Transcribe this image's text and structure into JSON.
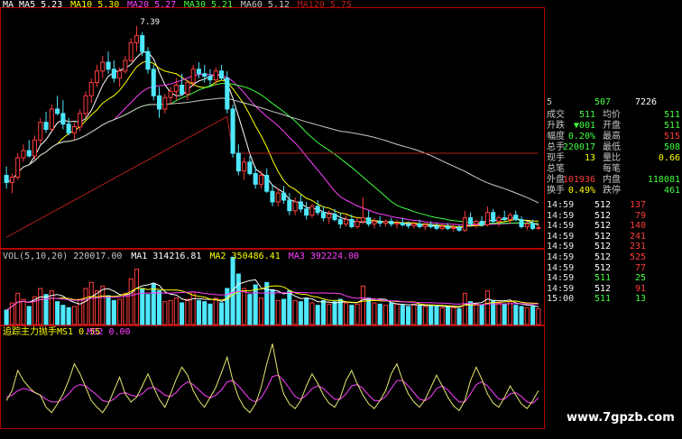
{
  "colors": {
    "up": "#ff3c3c",
    "down": "#4fe8ff",
    "white": "#ffffff",
    "yellow": "#ffff00",
    "magenta": "#ff40ff",
    "green": "#40ff40",
    "axis": "#b40000",
    "ma5": "#ffffff",
    "ma10": "#ffff00",
    "ma20": "#ff40ff",
    "ma30": "#40ff40",
    "ma60": "#c8c8c8",
    "ma120": "#b41e1e"
  },
  "price_legend": [
    {
      "text": "MA MA5 5.23",
      "color": "#ffffff"
    },
    {
      "text": "MA10 5.30",
      "color": "#ffff00"
    },
    {
      "text": "MA20 5.27",
      "color": "#ff40ff"
    },
    {
      "text": "MA30 5.21",
      "color": "#40ff40"
    },
    {
      "text": "MA60 5.12",
      "color": "#c8c8c8"
    },
    {
      "text": "MA120 5.75",
      "color": "#b41e1e"
    }
  ],
  "high_marker": "7.39",
  "volume_legend": [
    {
      "text": "VOL(5,10,20) 220017.00",
      "color": "#c8c8c8"
    },
    {
      "text": "MA1 314216.81",
      "color": "#ffffff"
    },
    {
      "text": "MA2 350486.41",
      "color": "#ffff00"
    },
    {
      "text": "MA3 392224.00",
      "color": "#ff40ff"
    }
  ],
  "indicator_legend": [
    {
      "text": "追踪主力抛手MS1 0.55",
      "color": "#ffff00"
    },
    {
      "text": "MS2 0.00",
      "color": "#ff40ff"
    }
  ],
  "quote_header": {
    "code": "5",
    "price": "507",
    "volume": "7226"
  },
  "quote_rows": [
    {
      "l1": "成交",
      "v1": "511",
      "l2": "均价",
      "v2": "511",
      "c1": "#40ff40",
      "c2": "#40ff40"
    },
    {
      "l1": "升跌",
      "v1": "▼001",
      "l2": "开盘",
      "v2": "511",
      "c1": "#40ff40",
      "c2": "#40ff40"
    },
    {
      "l1": "幅度",
      "v1": "0.20%",
      "l2": "最高",
      "v2": "515",
      "c1": "#40ff40",
      "c2": "#ff3c3c"
    },
    {
      "l1": "总手",
      "v1": "220017",
      "l2": "最低",
      "v2": "508",
      "c1": "#40ff40",
      "c2": "#40ff40"
    },
    {
      "l1": "现手",
      "v1": "13",
      "l2": "量比",
      "v2": "0.66",
      "c1": "#ffff00",
      "c2": "#ffff00"
    },
    {
      "l1": "总笔",
      "v1": "",
      "l2": "每笔",
      "v2": "",
      "c1": "#ffff00",
      "c2": "#ffff00"
    },
    {
      "l1": "外盘",
      "v1": "101936",
      "l2": "内盘",
      "v2": "118081",
      "c1": "#ff3c3c",
      "c2": "#40ff40"
    },
    {
      "l1": "换手",
      "v1": "0.49%",
      "l2": "跌停",
      "v2": "461",
      "c1": "#ffff00",
      "c2": "#40ff40"
    }
  ],
  "ticks": [
    {
      "time": "14:59",
      "price": "512",
      "vol": "137"
    },
    {
      "time": "14:59",
      "price": "512",
      "vol": "79"
    },
    {
      "time": "14:59",
      "price": "512",
      "vol": "140"
    },
    {
      "time": "14:59",
      "price": "512",
      "vol": "241"
    },
    {
      "time": "14:59",
      "price": "512",
      "vol": "231"
    },
    {
      "time": "14:59",
      "price": "512",
      "vol": "525"
    },
    {
      "time": "14:59",
      "price": "512",
      "vol": "77"
    },
    {
      "time": "14:59",
      "price": "511",
      "vol": "25"
    },
    {
      "time": "14:59",
      "price": "512",
      "vol": "91"
    },
    {
      "time": "15:00",
      "price": "511",
      "vol": "13"
    }
  ],
  "watermark": "www.7gpzb.com",
  "chart_data": {
    "type": "candlestick",
    "candles": [
      [
        5.7,
        5.8,
        5.55,
        5.62
      ],
      [
        5.62,
        5.72,
        5.5,
        5.68
      ],
      [
        5.68,
        5.95,
        5.65,
        5.9
      ],
      [
        5.9,
        6.05,
        5.85,
        5.98
      ],
      [
        5.98,
        6.1,
        5.9,
        5.92
      ],
      [
        5.92,
        6.15,
        5.88,
        6.1
      ],
      [
        6.1,
        6.35,
        6.05,
        6.3
      ],
      [
        6.3,
        6.42,
        6.18,
        6.22
      ],
      [
        6.22,
        6.5,
        6.2,
        6.45
      ],
      [
        6.45,
        6.6,
        6.38,
        6.4
      ],
      [
        6.4,
        6.55,
        6.22,
        6.28
      ],
      [
        6.28,
        6.35,
        6.15,
        6.18
      ],
      [
        6.18,
        6.3,
        6.1,
        6.25
      ],
      [
        6.25,
        6.45,
        6.2,
        6.4
      ],
      [
        6.4,
        6.65,
        6.35,
        6.6
      ],
      [
        6.6,
        6.8,
        6.52,
        6.75
      ],
      [
        6.75,
        6.95,
        6.7,
        6.88
      ],
      [
        6.88,
        7.05,
        6.8,
        6.98
      ],
      [
        6.98,
        7.1,
        6.85,
        6.9
      ],
      [
        6.9,
        7.0,
        6.75,
        6.8
      ],
      [
        6.8,
        6.92,
        6.7,
        6.88
      ],
      [
        6.88,
        7.05,
        6.85,
        7.0
      ],
      [
        7.0,
        7.25,
        6.98,
        7.2
      ],
      [
        7.2,
        7.39,
        7.1,
        7.28
      ],
      [
        7.28,
        7.32,
        7.05,
        7.1
      ],
      [
        7.1,
        7.15,
        6.85,
        6.9
      ],
      [
        6.9,
        6.95,
        6.55,
        6.6
      ],
      [
        6.6,
        6.7,
        6.35,
        6.45
      ],
      [
        6.45,
        6.62,
        6.4,
        6.58
      ],
      [
        6.58,
        6.7,
        6.5,
        6.65
      ],
      [
        6.65,
        6.8,
        6.55,
        6.72
      ],
      [
        6.72,
        6.85,
        6.6,
        6.62
      ],
      [
        6.62,
        6.78,
        6.55,
        6.75
      ],
      [
        6.75,
        6.95,
        6.7,
        6.9
      ],
      [
        6.9,
        6.98,
        6.8,
        6.85
      ],
      [
        6.85,
        6.95,
        6.75,
        6.82
      ],
      [
        6.82,
        6.9,
        6.7,
        6.78
      ],
      [
        6.78,
        6.92,
        6.72,
        6.88
      ],
      [
        6.88,
        6.95,
        6.78,
        6.8
      ],
      [
        6.8,
        6.88,
        6.4,
        6.45
      ],
      [
        6.45,
        6.5,
        5.9,
        5.95
      ],
      [
        5.95,
        6.05,
        5.7,
        5.75
      ],
      [
        5.75,
        5.9,
        5.65,
        5.85
      ],
      [
        5.85,
        5.92,
        5.7,
        5.72
      ],
      [
        5.72,
        5.8,
        5.55,
        5.6
      ],
      [
        5.6,
        5.75,
        5.55,
        5.7
      ],
      [
        5.7,
        5.78,
        5.5,
        5.52
      ],
      [
        5.52,
        5.6,
        5.35,
        5.4
      ],
      [
        5.4,
        5.55,
        5.35,
        5.5
      ],
      [
        5.5,
        5.58,
        5.38,
        5.42
      ],
      [
        5.42,
        5.5,
        5.25,
        5.3
      ],
      [
        5.3,
        5.45,
        5.25,
        5.4
      ],
      [
        5.4,
        5.48,
        5.28,
        5.32
      ],
      [
        5.32,
        5.4,
        5.2,
        5.25
      ],
      [
        5.25,
        5.38,
        5.22,
        5.35
      ],
      [
        5.35,
        5.42,
        5.25,
        5.28
      ],
      [
        5.28,
        5.35,
        5.18,
        5.22
      ],
      [
        5.22,
        5.3,
        5.15,
        5.26
      ],
      [
        5.26,
        5.32,
        5.18,
        5.2
      ],
      [
        5.2,
        5.28,
        5.1,
        5.15
      ],
      [
        5.15,
        5.25,
        5.12,
        5.2
      ],
      [
        5.2,
        5.26,
        5.1,
        5.12
      ],
      [
        5.12,
        5.22,
        5.1,
        5.18
      ],
      [
        5.18,
        5.45,
        5.15,
        5.22
      ],
      [
        5.22,
        5.3,
        5.12,
        5.15
      ],
      [
        5.15,
        5.22,
        5.1,
        5.18
      ],
      [
        5.18,
        5.24,
        5.12,
        5.16
      ],
      [
        5.16,
        5.2,
        5.12,
        5.18
      ],
      [
        5.18,
        5.22,
        5.12,
        5.15
      ],
      [
        5.15,
        5.2,
        5.1,
        5.16
      ],
      [
        5.16,
        5.22,
        5.12,
        5.14
      ],
      [
        5.14,
        5.18,
        5.1,
        5.13
      ],
      [
        5.13,
        5.18,
        5.1,
        5.15
      ],
      [
        5.15,
        5.2,
        5.1,
        5.12
      ],
      [
        5.12,
        5.16,
        5.08,
        5.14
      ],
      [
        5.14,
        5.18,
        5.1,
        5.12
      ],
      [
        5.12,
        5.16,
        5.08,
        5.1
      ],
      [
        5.1,
        5.15,
        5.08,
        5.12
      ],
      [
        5.12,
        5.16,
        5.08,
        5.1
      ],
      [
        5.1,
        5.14,
        5.06,
        5.11
      ],
      [
        5.11,
        5.14,
        5.06,
        5.08
      ],
      [
        5.08,
        5.3,
        5.06,
        5.22
      ],
      [
        5.22,
        5.28,
        5.12,
        5.15
      ],
      [
        5.15,
        5.2,
        5.1,
        5.18
      ],
      [
        5.18,
        5.24,
        5.12,
        5.14
      ],
      [
        5.14,
        5.35,
        5.12,
        5.28
      ],
      [
        5.28,
        5.32,
        5.15,
        5.18
      ],
      [
        5.18,
        5.25,
        5.12,
        5.22
      ],
      [
        5.22,
        5.3,
        5.18,
        5.2
      ],
      [
        5.2,
        5.28,
        5.15,
        5.25
      ],
      [
        5.25,
        5.3,
        5.18,
        5.2
      ],
      [
        5.2,
        5.24,
        5.1,
        5.12
      ],
      [
        5.12,
        5.18,
        5.08,
        5.15
      ],
      [
        5.15,
        5.2,
        5.08,
        5.1
      ],
      [
        5.1,
        5.15,
        5.08,
        5.11
      ]
    ],
    "volume": [
      120,
      180,
      260,
      210,
      150,
      230,
      300,
      250,
      280,
      190,
      160,
      140,
      150,
      210,
      300,
      350,
      280,
      320,
      240,
      200,
      210,
      260,
      380,
      460,
      300,
      250,
      340,
      280,
      190,
      200,
      220,
      180,
      210,
      270,
      200,
      190,
      170,
      220,
      180,
      300,
      560,
      420,
      300,
      250,
      330,
      220,
      350,
      290,
      200,
      210,
      280,
      200,
      190,
      220,
      180,
      160,
      200,
      170,
      190,
      210,
      180,
      160,
      170,
      320,
      220,
      180,
      170,
      160,
      180,
      170,
      160,
      150,
      170,
      160,
      150,
      160,
      150,
      140,
      150,
      140,
      130,
      260,
      190,
      170,
      160,
      280,
      200,
      180,
      170,
      190,
      160,
      150,
      140,
      150,
      130
    ],
    "indicator_ms1": [
      0.4,
      0.55,
      0.85,
      0.7,
      0.6,
      0.52,
      0.48,
      0.3,
      0.22,
      0.35,
      0.5,
      0.7,
      0.95,
      0.8,
      0.6,
      0.4,
      0.3,
      0.22,
      0.35,
      0.55,
      0.75,
      0.5,
      0.38,
      0.45,
      0.62,
      0.8,
      0.6,
      0.42,
      0.3,
      0.5,
      0.72,
      0.9,
      0.78,
      0.55,
      0.4,
      0.3,
      0.45,
      0.6,
      0.82,
      1.05,
      0.7,
      0.45,
      0.3,
      0.22,
      0.35,
      0.6,
      0.95,
      1.25,
      0.8,
      0.5,
      0.35,
      0.28,
      0.4,
      0.62,
      0.8,
      0.66,
      0.48,
      0.36,
      0.3,
      0.45,
      0.7,
      0.85,
      0.65,
      0.48,
      0.35,
      0.28,
      0.4,
      0.55,
      0.8,
      0.95,
      0.7,
      0.5,
      0.38,
      0.3,
      0.42,
      0.6,
      0.78,
      0.62,
      0.45,
      0.32,
      0.25,
      0.4,
      0.7,
      0.9,
      0.72,
      0.5,
      0.36,
      0.3,
      0.45,
      0.62,
      0.48,
      0.35,
      0.28,
      0.4,
      0.55
    ],
    "indicator_ms2": [
      0.45,
      0.48,
      0.55,
      0.58,
      0.56,
      0.52,
      0.48,
      0.42,
      0.38,
      0.38,
      0.42,
      0.5,
      0.6,
      0.64,
      0.62,
      0.55,
      0.48,
      0.4,
      0.38,
      0.42,
      0.5,
      0.52,
      0.48,
      0.46,
      0.5,
      0.58,
      0.6,
      0.55,
      0.48,
      0.46,
      0.52,
      0.62,
      0.68,
      0.64,
      0.56,
      0.48,
      0.44,
      0.48,
      0.56,
      0.68,
      0.7,
      0.62,
      0.52,
      0.42,
      0.38,
      0.44,
      0.58,
      0.76,
      0.78,
      0.7,
      0.58,
      0.46,
      0.42,
      0.48,
      0.58,
      0.62,
      0.58,
      0.5,
      0.42,
      0.42,
      0.5,
      0.62,
      0.64,
      0.58,
      0.48,
      0.4,
      0.4,
      0.46,
      0.58,
      0.7,
      0.7,
      0.62,
      0.52,
      0.42,
      0.4,
      0.46,
      0.58,
      0.62,
      0.56,
      0.46,
      0.38,
      0.38,
      0.5,
      0.64,
      0.68,
      0.62,
      0.52,
      0.42,
      0.42,
      0.5,
      0.52,
      0.46,
      0.38,
      0.36,
      0.44
    ],
    "price_range": [
      4.9,
      7.5
    ],
    "volume_range": [
      0,
      600
    ],
    "indicator_range": [
      0,
      1.35
    ]
  }
}
